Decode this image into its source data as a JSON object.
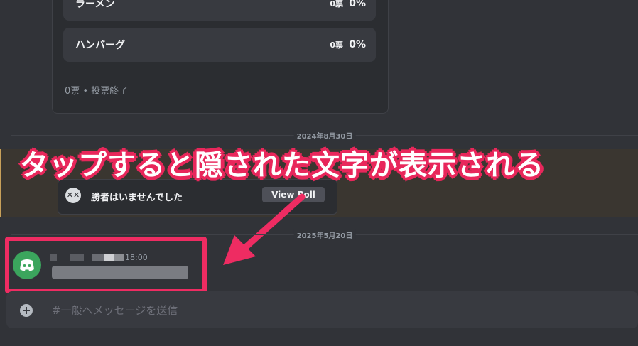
{
  "poll": {
    "options": [
      {
        "label": "ラーメン",
        "votes": "0票",
        "percent": "0%"
      },
      {
        "label": "ハンバーグ",
        "votes": "0票",
        "percent": "0%"
      }
    ],
    "footer": "0票 • 投票終了"
  },
  "dividers": {
    "date1": "2024年8月30日",
    "date2": "2025年5月20日"
  },
  "poll_result": {
    "text": "勝者はいませんでした",
    "view_label": "View Poll"
  },
  "annotation": {
    "text": "タップすると隠された文字が表示される",
    "color": "#e8275b"
  },
  "message": {
    "timestamp": "18:00"
  },
  "composer": {
    "placeholder": "#一般へメッセージを送信"
  },
  "colors": {
    "background": "#313338",
    "highlight": "#ee2c62",
    "avatar": "#3ba55d"
  }
}
